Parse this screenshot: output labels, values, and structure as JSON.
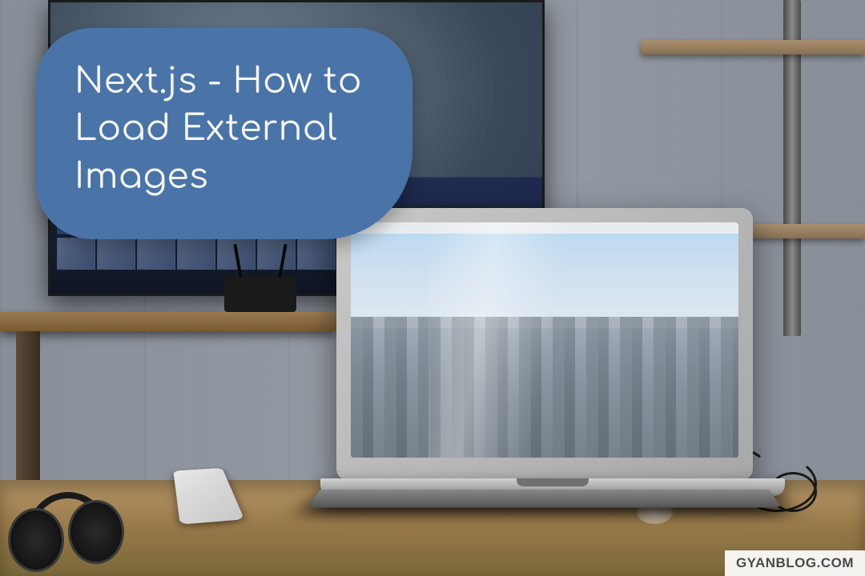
{
  "badge": {
    "title": "Next.js - How to Load External Images"
  },
  "watermark": {
    "text": "GYANBLOG.COM"
  },
  "colors": {
    "badge_bg": "#4a74a8",
    "badge_text": "#f5f5f0"
  }
}
